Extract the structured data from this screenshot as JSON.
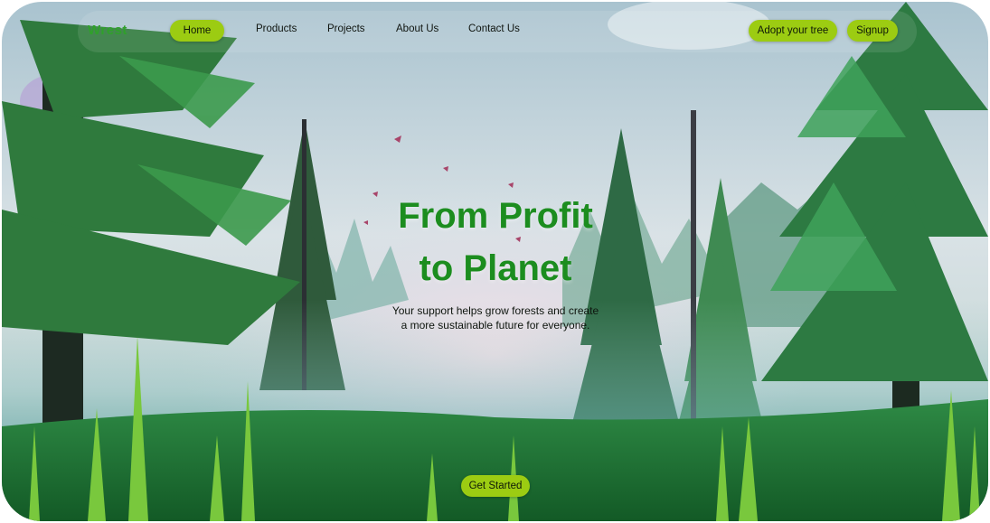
{
  "brand": {
    "logo_text": "Wrest"
  },
  "nav": {
    "home": "Home",
    "products": "Products",
    "projects": "Projects",
    "about": "About Us",
    "contact": "Contact Us"
  },
  "actions": {
    "adopt": "Adopt your tree",
    "signup": "Signup"
  },
  "hero": {
    "title_line1": "From Profit",
    "title_line2": "to Planet",
    "subtitle_line1": "Your support helps grow forests and create",
    "subtitle_line2": "a more sustainable future for everyone.",
    "cta": "Get Started"
  },
  "colors": {
    "accent": "#9ccc12",
    "title": "#1c8d1f",
    "logo": "#2fa12a"
  }
}
